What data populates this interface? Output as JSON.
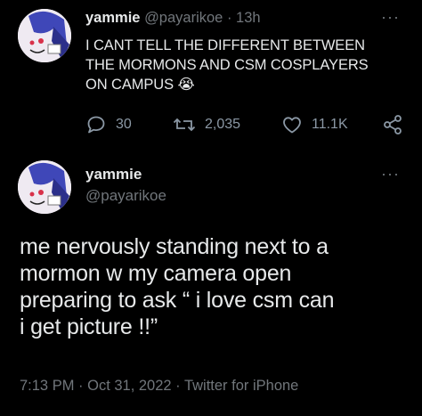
{
  "tweet1": {
    "display_name": "yammie",
    "handle": "@payarikoe",
    "separator": "·",
    "time_ago": "13h",
    "text_lines": [
      "I CANT TELL THE DIFFERENT BETWEEN",
      "THE MORMONS AND CSM COSPLAYERS",
      "ON CAMPUS"
    ],
    "emoji": "😭",
    "replies": "30",
    "retweets": "2,035",
    "likes": "11.1K"
  },
  "tweet2": {
    "display_name": "yammie",
    "handle": "@payarikoe",
    "text_lines": [
      "me nervously standing next to a",
      "mormon w my camera open",
      "preparing to ask “ i love csm can",
      "i get picture !!”"
    ],
    "timestamp": "7:13 PM · Oct 31, 2022 · Twitter for iPhone"
  },
  "icons": {
    "more": "more-dots-icon",
    "reply": "reply-bubble-icon",
    "retweet": "retweet-icon",
    "like": "heart-icon",
    "share": "share-icon"
  },
  "colors": {
    "background": "#000000",
    "text": "#e7e9ea",
    "muted": "#71767b"
  }
}
